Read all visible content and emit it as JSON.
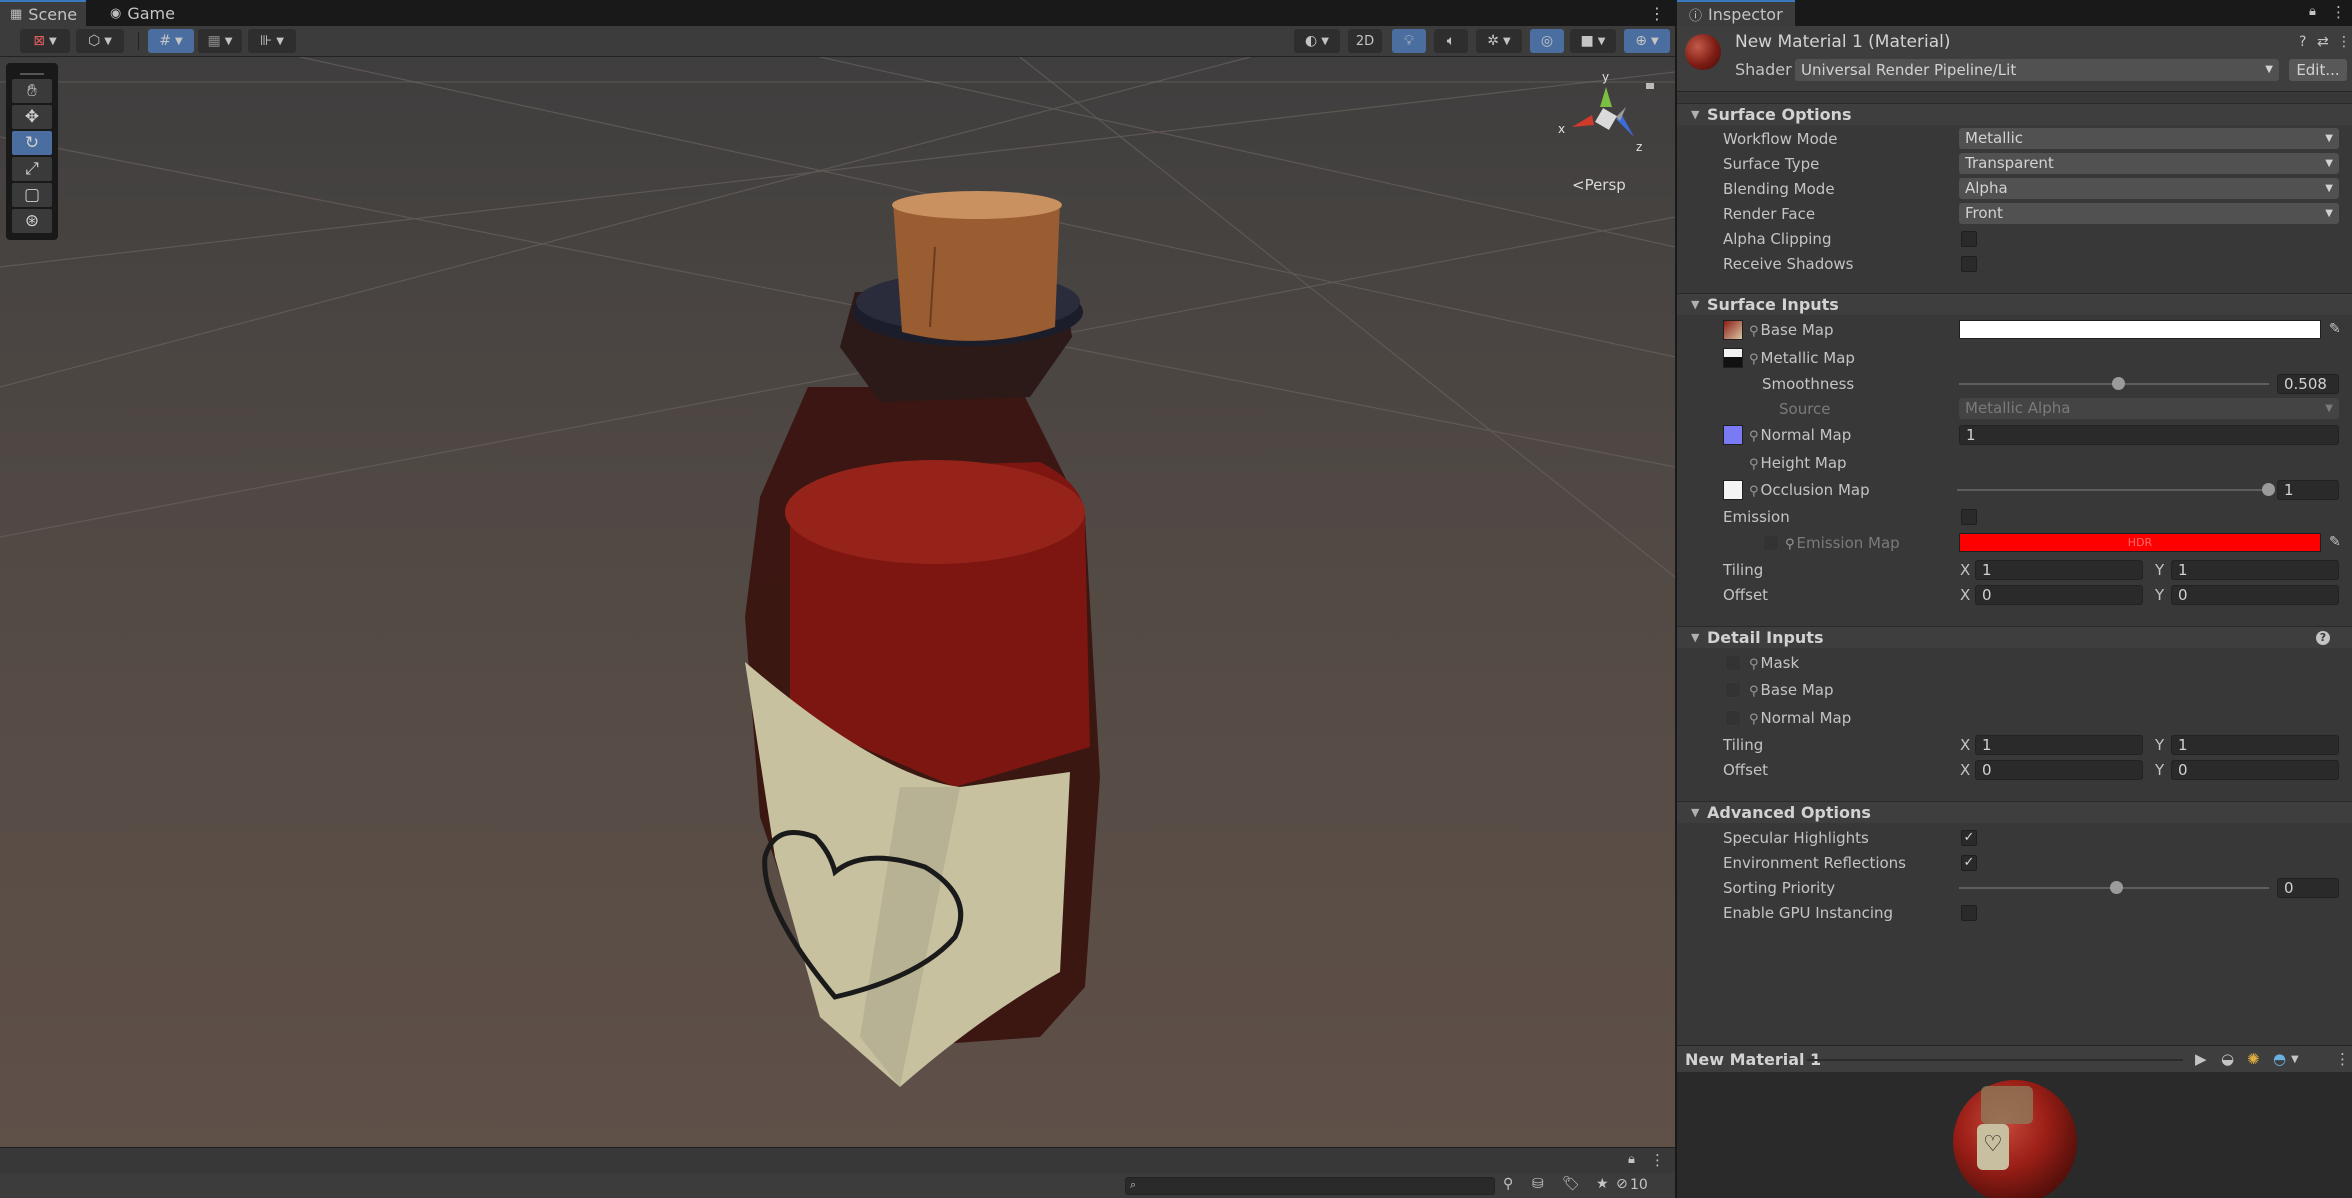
{
  "scene_tabs": [
    {
      "label": "Scene",
      "icon": "grid-icon"
    },
    {
      "label": "Game",
      "icon": "gamepad-icon"
    }
  ],
  "scene_toolbar": {
    "mode_2d_label": "2D"
  },
  "viewport": {
    "persp_label": "<Persp",
    "gizmo": {
      "x": "x",
      "y": "y",
      "z": "z"
    }
  },
  "scene_footer": {
    "hidden_count": "10",
    "search_placeholder": ""
  },
  "inspector": {
    "tab_label": "Inspector",
    "material_title": "New Material 1 (Material)",
    "shader_label": "Shader",
    "shader_value": "Universal Render Pipeline/Lit",
    "edit_label": "Edit...",
    "surface_options": {
      "title": "Surface Options",
      "workflow_label": "Workflow Mode",
      "workflow_value": "Metallic",
      "surface_type_label": "Surface Type",
      "surface_type_value": "Transparent",
      "blending_label": "Blending Mode",
      "blending_value": "Alpha",
      "render_face_label": "Render Face",
      "render_face_value": "Front",
      "alpha_clip_label": "Alpha Clipping",
      "alpha_clip_checked": false,
      "receive_shadows_label": "Receive Shadows",
      "receive_shadows_checked": false
    },
    "surface_inputs": {
      "title": "Surface Inputs",
      "base_map_label": "Base Map",
      "metallic_map_label": "Metallic Map",
      "smoothness_label": "Smoothness",
      "smoothness_value": "0.508",
      "smoothness_fraction": 0.508,
      "source_label": "Source",
      "source_value": "Metallic Alpha",
      "normal_map_label": "Normal Map",
      "normal_map_value": "1",
      "height_map_label": "Height Map",
      "occlusion_map_label": "Occlusion Map",
      "occlusion_value": "1",
      "occlusion_fraction": 1.0,
      "emission_label": "Emission",
      "emission_map_label": "Emission Map",
      "emission_hdr_label": "HDR",
      "emission_color": "#ff0000",
      "tiling_label": "Tiling",
      "tiling_x": "1",
      "tiling_y": "1",
      "offset_label": "Offset",
      "offset_x": "0",
      "offset_y": "0",
      "x_label": "X",
      "y_label": "Y"
    },
    "detail_inputs": {
      "title": "Detail Inputs",
      "mask_label": "Mask",
      "base_map_label": "Base Map",
      "normal_map_label": "Normal Map",
      "tiling_label": "Tiling",
      "tiling_x": "1",
      "tiling_y": "1",
      "offset_label": "Offset",
      "offset_x": "0",
      "offset_y": "0"
    },
    "advanced_options": {
      "title": "Advanced Options",
      "specular_label": "Specular Highlights",
      "specular_checked": true,
      "env_reflections_label": "Environment Reflections",
      "env_reflections_checked": true,
      "sorting_priority_label": "Sorting Priority",
      "sorting_priority_value": "0",
      "sorting_fraction": 0.5,
      "gpu_instancing_label": "Enable GPU Instancing",
      "gpu_instancing_checked": false
    },
    "preview_title": "New Material 1"
  },
  "colors": {
    "accent_blue": "#4b6ea0",
    "tab_highlight": "#3a79bb",
    "liquid_red": "#8b1a14",
    "cork": "#b0703f",
    "label_paper": "#c9c4a3"
  }
}
